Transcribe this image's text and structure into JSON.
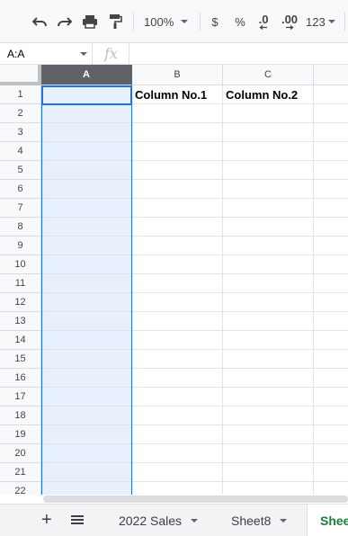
{
  "toolbar": {
    "zoom": "100%",
    "currency_label": "$",
    "percent_label": "%",
    "decrease_decimal_label": ".0",
    "increase_decimal_label": ".00",
    "more_formats_label": "123"
  },
  "formula_bar": {
    "name_box": "A:A",
    "fx_label": "fx"
  },
  "columns": [
    "A",
    "B",
    "C"
  ],
  "rows": [
    "1",
    "2",
    "3",
    "4",
    "5",
    "6",
    "7",
    "8",
    "9",
    "10",
    "11",
    "12",
    "13",
    "14",
    "15",
    "16",
    "17",
    "18",
    "19",
    "20",
    "21",
    "22"
  ],
  "cells": {
    "B1": "Column No.1",
    "C1": "Column No.2"
  },
  "sheets": {
    "tabs": [
      "2022 Sales",
      "Sheet8",
      "Sheet"
    ]
  },
  "colors": {
    "selection_blue": "#1a73e8",
    "selection_fill": "#e8f0fe",
    "active_tab_green": "#188038"
  }
}
